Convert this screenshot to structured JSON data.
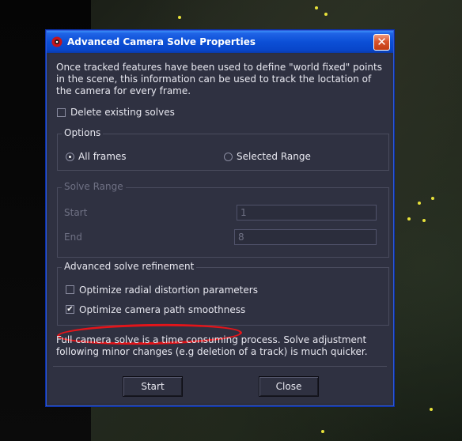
{
  "dialog": {
    "title": "Advanced Camera Solve Properties",
    "close_symbol": "✕",
    "intro": "Once tracked features have been used to define \"world fixed\" points in the scene, this information can be used to track the loctation of the camera for every frame.",
    "delete_existing": {
      "label": "Delete existing solves",
      "checked": false
    },
    "options": {
      "title": "Options",
      "all_frames": {
        "label": "All frames",
        "selected": true
      },
      "selected_range": {
        "label": "Selected Range",
        "selected": false
      }
    },
    "solve_range": {
      "title": "Solve Range",
      "start_label": "Start",
      "start_value": "1",
      "end_label": "End",
      "end_value": "8"
    },
    "refinement": {
      "title": "Advanced solve refinement",
      "radial": {
        "label": "Optimize radial distortion parameters",
        "checked": false
      },
      "smoothness": {
        "label": "Optimize camera path smoothness",
        "checked": true,
        "check_mark": "✔"
      }
    },
    "footer_note": "Full camera solve is a time consuming process. Solve adjustment following minor changes (e.g deletion of a track) is much quicker.",
    "buttons": {
      "start": "Start",
      "close": "Close"
    }
  },
  "colors": {
    "title_bar": "#0c4fd6",
    "dialog_bg": "#2f3141",
    "highlight": "#e2151a",
    "close_button": "#d8542c"
  }
}
